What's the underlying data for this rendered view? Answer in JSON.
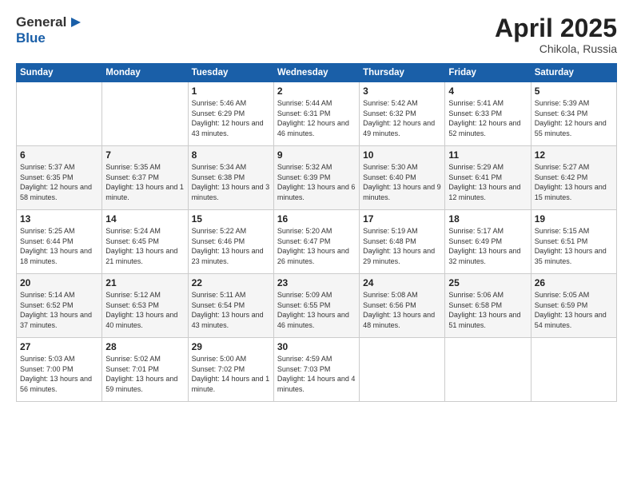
{
  "header": {
    "logo_general": "General",
    "logo_blue": "Blue",
    "title": "April 2025",
    "location": "Chikola, Russia"
  },
  "weekdays": [
    "Sunday",
    "Monday",
    "Tuesday",
    "Wednesday",
    "Thursday",
    "Friday",
    "Saturday"
  ],
  "weeks": [
    [
      null,
      null,
      {
        "day": 1,
        "sunrise": "5:46 AM",
        "sunset": "6:29 PM",
        "daylight": "12 hours and 43 minutes."
      },
      {
        "day": 2,
        "sunrise": "5:44 AM",
        "sunset": "6:31 PM",
        "daylight": "12 hours and 46 minutes."
      },
      {
        "day": 3,
        "sunrise": "5:42 AM",
        "sunset": "6:32 PM",
        "daylight": "12 hours and 49 minutes."
      },
      {
        "day": 4,
        "sunrise": "5:41 AM",
        "sunset": "6:33 PM",
        "daylight": "12 hours and 52 minutes."
      },
      {
        "day": 5,
        "sunrise": "5:39 AM",
        "sunset": "6:34 PM",
        "daylight": "12 hours and 55 minutes."
      }
    ],
    [
      {
        "day": 6,
        "sunrise": "5:37 AM",
        "sunset": "6:35 PM",
        "daylight": "12 hours and 58 minutes."
      },
      {
        "day": 7,
        "sunrise": "5:35 AM",
        "sunset": "6:37 PM",
        "daylight": "13 hours and 1 minute."
      },
      {
        "day": 8,
        "sunrise": "5:34 AM",
        "sunset": "6:38 PM",
        "daylight": "13 hours and 3 minutes."
      },
      {
        "day": 9,
        "sunrise": "5:32 AM",
        "sunset": "6:39 PM",
        "daylight": "13 hours and 6 minutes."
      },
      {
        "day": 10,
        "sunrise": "5:30 AM",
        "sunset": "6:40 PM",
        "daylight": "13 hours and 9 minutes."
      },
      {
        "day": 11,
        "sunrise": "5:29 AM",
        "sunset": "6:41 PM",
        "daylight": "13 hours and 12 minutes."
      },
      {
        "day": 12,
        "sunrise": "5:27 AM",
        "sunset": "6:42 PM",
        "daylight": "13 hours and 15 minutes."
      }
    ],
    [
      {
        "day": 13,
        "sunrise": "5:25 AM",
        "sunset": "6:44 PM",
        "daylight": "13 hours and 18 minutes."
      },
      {
        "day": 14,
        "sunrise": "5:24 AM",
        "sunset": "6:45 PM",
        "daylight": "13 hours and 21 minutes."
      },
      {
        "day": 15,
        "sunrise": "5:22 AM",
        "sunset": "6:46 PM",
        "daylight": "13 hours and 23 minutes."
      },
      {
        "day": 16,
        "sunrise": "5:20 AM",
        "sunset": "6:47 PM",
        "daylight": "13 hours and 26 minutes."
      },
      {
        "day": 17,
        "sunrise": "5:19 AM",
        "sunset": "6:48 PM",
        "daylight": "13 hours and 29 minutes."
      },
      {
        "day": 18,
        "sunrise": "5:17 AM",
        "sunset": "6:49 PM",
        "daylight": "13 hours and 32 minutes."
      },
      {
        "day": 19,
        "sunrise": "5:15 AM",
        "sunset": "6:51 PM",
        "daylight": "13 hours and 35 minutes."
      }
    ],
    [
      {
        "day": 20,
        "sunrise": "5:14 AM",
        "sunset": "6:52 PM",
        "daylight": "13 hours and 37 minutes."
      },
      {
        "day": 21,
        "sunrise": "5:12 AM",
        "sunset": "6:53 PM",
        "daylight": "13 hours and 40 minutes."
      },
      {
        "day": 22,
        "sunrise": "5:11 AM",
        "sunset": "6:54 PM",
        "daylight": "13 hours and 43 minutes."
      },
      {
        "day": 23,
        "sunrise": "5:09 AM",
        "sunset": "6:55 PM",
        "daylight": "13 hours and 46 minutes."
      },
      {
        "day": 24,
        "sunrise": "5:08 AM",
        "sunset": "6:56 PM",
        "daylight": "13 hours and 48 minutes."
      },
      {
        "day": 25,
        "sunrise": "5:06 AM",
        "sunset": "6:58 PM",
        "daylight": "13 hours and 51 minutes."
      },
      {
        "day": 26,
        "sunrise": "5:05 AM",
        "sunset": "6:59 PM",
        "daylight": "13 hours and 54 minutes."
      }
    ],
    [
      {
        "day": 27,
        "sunrise": "5:03 AM",
        "sunset": "7:00 PM",
        "daylight": "13 hours and 56 minutes."
      },
      {
        "day": 28,
        "sunrise": "5:02 AM",
        "sunset": "7:01 PM",
        "daylight": "13 hours and 59 minutes."
      },
      {
        "day": 29,
        "sunrise": "5:00 AM",
        "sunset": "7:02 PM",
        "daylight": "14 hours and 1 minute."
      },
      {
        "day": 30,
        "sunrise": "4:59 AM",
        "sunset": "7:03 PM",
        "daylight": "14 hours and 4 minutes."
      },
      null,
      null,
      null
    ]
  ]
}
